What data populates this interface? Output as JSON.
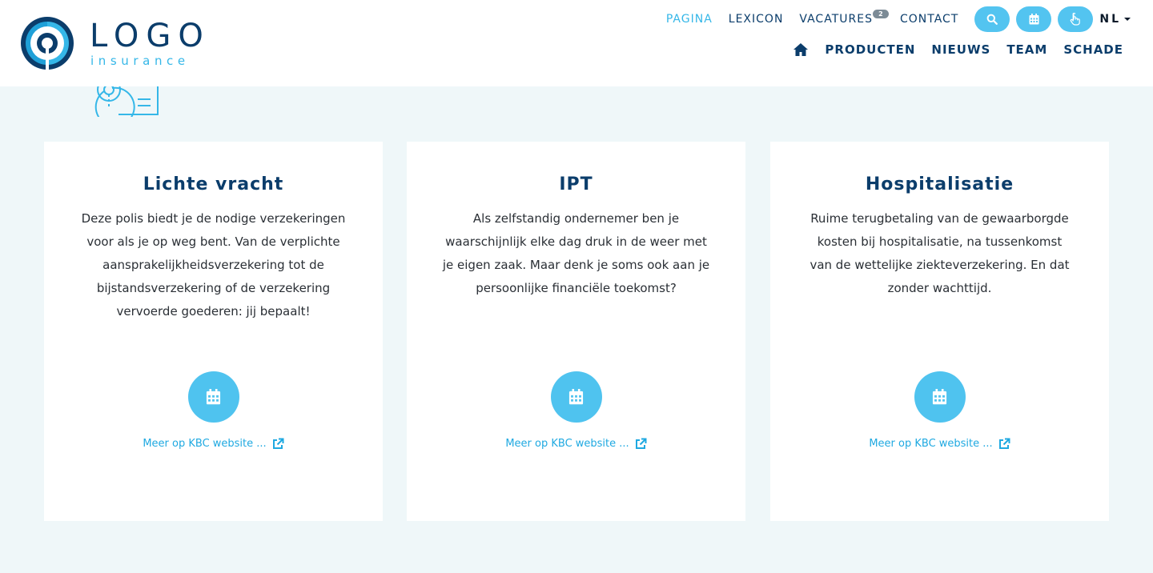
{
  "logo": {
    "word": "LOGO",
    "sub": "insurance"
  },
  "colors": {
    "navy": "#0b3d6b",
    "accent": "#35b7e8",
    "button": "#4fc3ef",
    "background": "#eff7f9"
  },
  "topnav": {
    "items": [
      {
        "label": "PAGINA",
        "active": true
      },
      {
        "label": "LEXICON"
      },
      {
        "label": "VACATURES",
        "badge": "2"
      },
      {
        "label": "CONTACT"
      }
    ],
    "icons": [
      "search-icon",
      "calendar-icon",
      "hand-pointer-icon"
    ],
    "language": "NL"
  },
  "mainnav": {
    "home_icon": "home-icon",
    "items": [
      "PRODUCTEN",
      "NIEUWS",
      "TEAM",
      "SCHADE"
    ]
  },
  "cards": [
    {
      "title": "Lichte vracht",
      "text": "Deze polis biedt je de nodige verzekeringen voor als je op weg bent. Van de verplichte aansprakelijkheidsverzekering tot de bijstandsverzekering of de verzekering vervoerde goederen: jij bepaalt!",
      "link": "Meer op KBC website ...",
      "icon": "calendar-icon"
    },
    {
      "title": "IPT",
      "text": "Als zelfstandig ondernemer ben je waarschijnlijk elke dag druk in de weer met je eigen zaak. Maar denk je soms ook aan je persoonlijke financiële toekomst?",
      "link": "Meer op KBC website ...",
      "icon": "calendar-icon"
    },
    {
      "title": "Hospitalisatie",
      "text": "Ruime terugbetaling van de gewaarborgde kosten bij hospitalisatie, na tussenkomst van de wettelijke ziekteverzekering. En dat zonder wachttijd.",
      "link": "Meer op KBC website ...",
      "icon": "calendar-icon"
    }
  ]
}
